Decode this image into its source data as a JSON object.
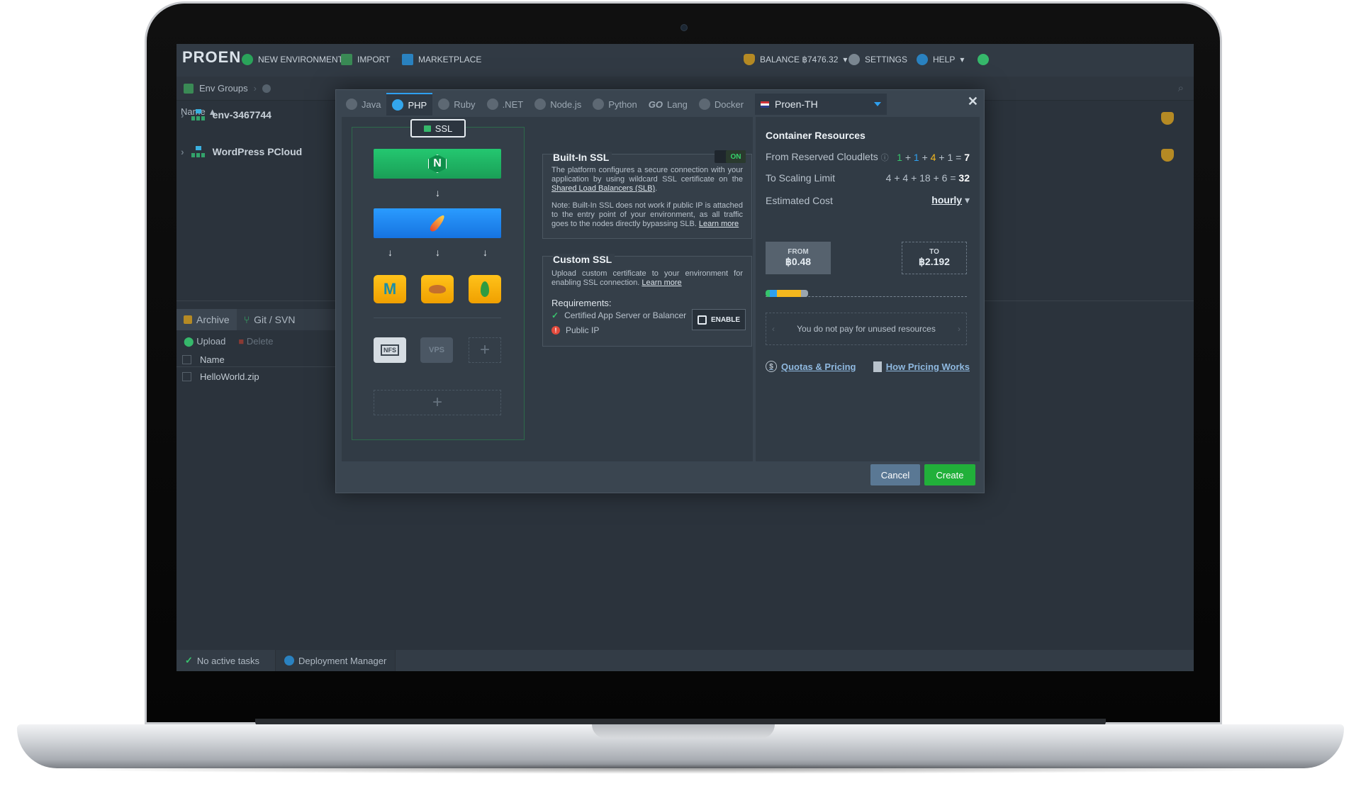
{
  "topbar": {
    "logo": "PROEN",
    "new_env": "NEW ENVIRONMENT",
    "import": "IMPORT",
    "marketplace": "MARKETPLACE",
    "balance": "BALANCE ฿7476.32",
    "settings": "SETTINGS",
    "help": "HELP"
  },
  "subbar": {
    "env_groups": "Env Groups"
  },
  "env_list": {
    "name_header": "Name ▲",
    "items": [
      "env-3467744",
      "WordPress PCloud"
    ]
  },
  "lower": {
    "tabs": [
      "Archive",
      "Git / SVN"
    ],
    "upload": "Upload",
    "delete": "Delete",
    "name_col": "Name",
    "files": [
      "HelloWorld.zip"
    ]
  },
  "footer": {
    "tasks": "No active tasks",
    "deploy": "Deployment Manager"
  },
  "dialog": {
    "stack_tabs": [
      "Java",
      "PHP",
      "Ruby",
      ".NET",
      "Node.js",
      "Python",
      "Lang",
      "Docker"
    ],
    "go_label": "GO",
    "region": "Proen-TH",
    "ssl_label": "SSL",
    "storage": {
      "nfs": "NFS",
      "vps": "VPS"
    },
    "builtin_ssl": {
      "title": "Built-In SSL",
      "toggle": "ON",
      "text1a": "The platform configures a secure connection with your application by using wildcard SSL certificate on the ",
      "text1_link": "Shared Load Balancers (SLB)",
      "text1b": ".",
      "text2a": "Note: Built-In SSL does not work if public IP is attached to the entry point of your environment, as all traffic goes to the nodes directly bypassing SLB. ",
      "text2_link": "Learn more"
    },
    "custom_ssl": {
      "title": "Custom SSL",
      "text_a": "Upload custom certificate to your environment for enabling SSL connection. ",
      "text_link": "Learn more",
      "requirements": "Requirements:",
      "req1": "Certified App Server or Balancer",
      "req2": "Public IP",
      "enable": "ENABLE"
    },
    "resources": {
      "title": "Container Resources",
      "reserved_label": "From Reserved Cloudlets",
      "reserved": [
        "1",
        "1",
        "4",
        "1"
      ],
      "reserved_total": "7",
      "scaling_label": "To Scaling Limit",
      "scaling_expr": "4 + 4 + 18 + 6 =",
      "scaling_total": "32",
      "cost_label": "Estimated Cost",
      "cost_period": "hourly",
      "from_label": "FROM",
      "from_value": "฿0.48",
      "to_label": "TO",
      "to_value": "฿2.192",
      "unused": "You do not pay for unused resources",
      "quotas": "Quotas & Pricing",
      "how": "How Pricing Works"
    },
    "cancel": "Cancel",
    "create": "Create"
  },
  "colors": {
    "accent": "#2ea0f0",
    "create": "#21b03a",
    "balancer": "#24c770",
    "appserver": "#2a9bff",
    "db": "#ffc21a"
  }
}
